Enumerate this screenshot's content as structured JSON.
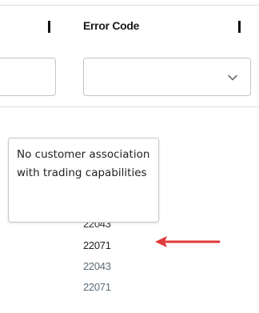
{
  "table": {
    "columns": [
      {
        "label": ""
      },
      {
        "label": "Error Code"
      }
    ],
    "filters": {
      "text_input_value": "",
      "select_value": ""
    },
    "rows": [
      {
        "error_code": "22043"
      },
      {
        "error_code": "22071"
      },
      {
        "error_code": "22043"
      },
      {
        "error_code": "22071"
      }
    ]
  },
  "tooltip": {
    "text": "No customer association with trading capabilities"
  },
  "annotation": {
    "arrow_color": "#e03a3a"
  },
  "icons": {
    "select_caret": "chevron-down-icon",
    "annotation": "red-arrow-icon"
  }
}
